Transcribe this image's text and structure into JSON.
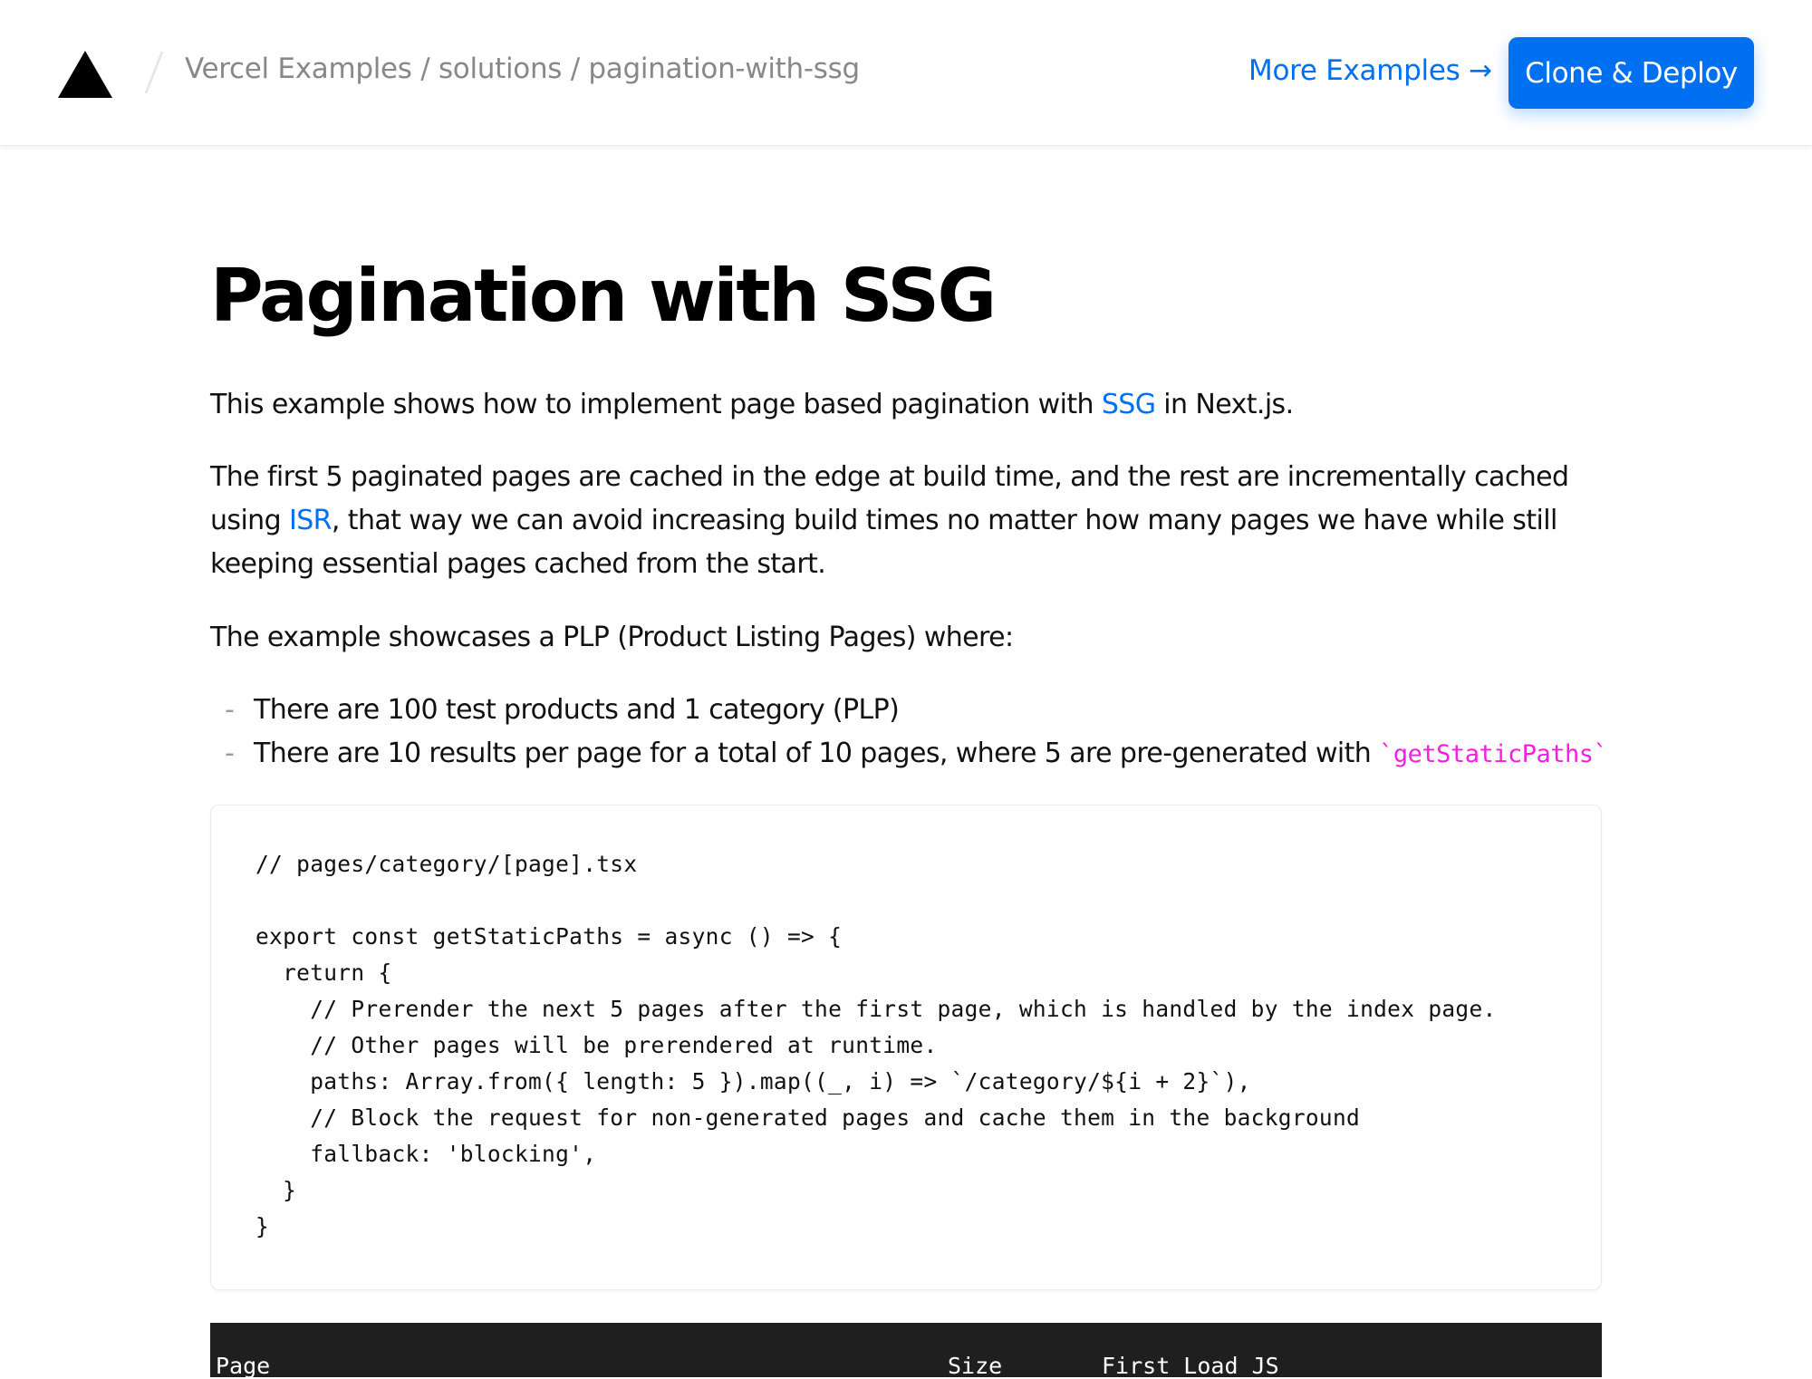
{
  "header": {
    "logo": "vercel-triangle-logo",
    "breadcrumb": [
      "Vercel Examples",
      "solutions",
      "pagination-with-ssg"
    ],
    "breadcrumb_sep": " / ",
    "more_examples": "More Examples →",
    "clone_deploy": "Clone & Deploy"
  },
  "main": {
    "title": "Pagination with SSG",
    "intro": {
      "before": "This example shows how to implement page based pagination with ",
      "link": "SSG",
      "after": " in Next.js."
    },
    "paragraph2": {
      "before": "The first 5 paginated pages are cached in the edge at build time, and the rest are incrementally cached using ",
      "link": "ISR",
      "after": ", that way we can avoid increasing build times no matter how many pages we have while still keeping essential pages cached from the start."
    },
    "paragraph3": "The example showcases a PLP (Product Listing Pages) where:",
    "list": [
      {
        "text": "There are 100 test products and 1 category (PLP)",
        "code": ""
      },
      {
        "text": "There are 10 results per page for a total of 10 pages, where 5 are pre-generated with ",
        "code": "`getStaticPaths`"
      }
    ],
    "list_bullet": "-",
    "code": "// pages/category/[page].tsx\n\nexport const getStaticPaths = async () => {\n  return {\n    // Prerender the next 5 pages after the first page, which is handled by the index page.\n    // Other pages will be prerendered at runtime.\n    paths: Array.from({ length: 5 }).map((_, i) => `/category/${i + 2}`),\n    // Block the request for non-generated pages and cache them in the background\n    fallback: 'blocking',\n  }\n}",
    "table_headers": [
      "Page",
      "Size",
      "First Load JS"
    ]
  },
  "colors": {
    "accent": "#0070f3",
    "inline_code": "#f81ce5",
    "breadcrumb": "#888888",
    "table_header_bg": "#1f1f1f"
  }
}
